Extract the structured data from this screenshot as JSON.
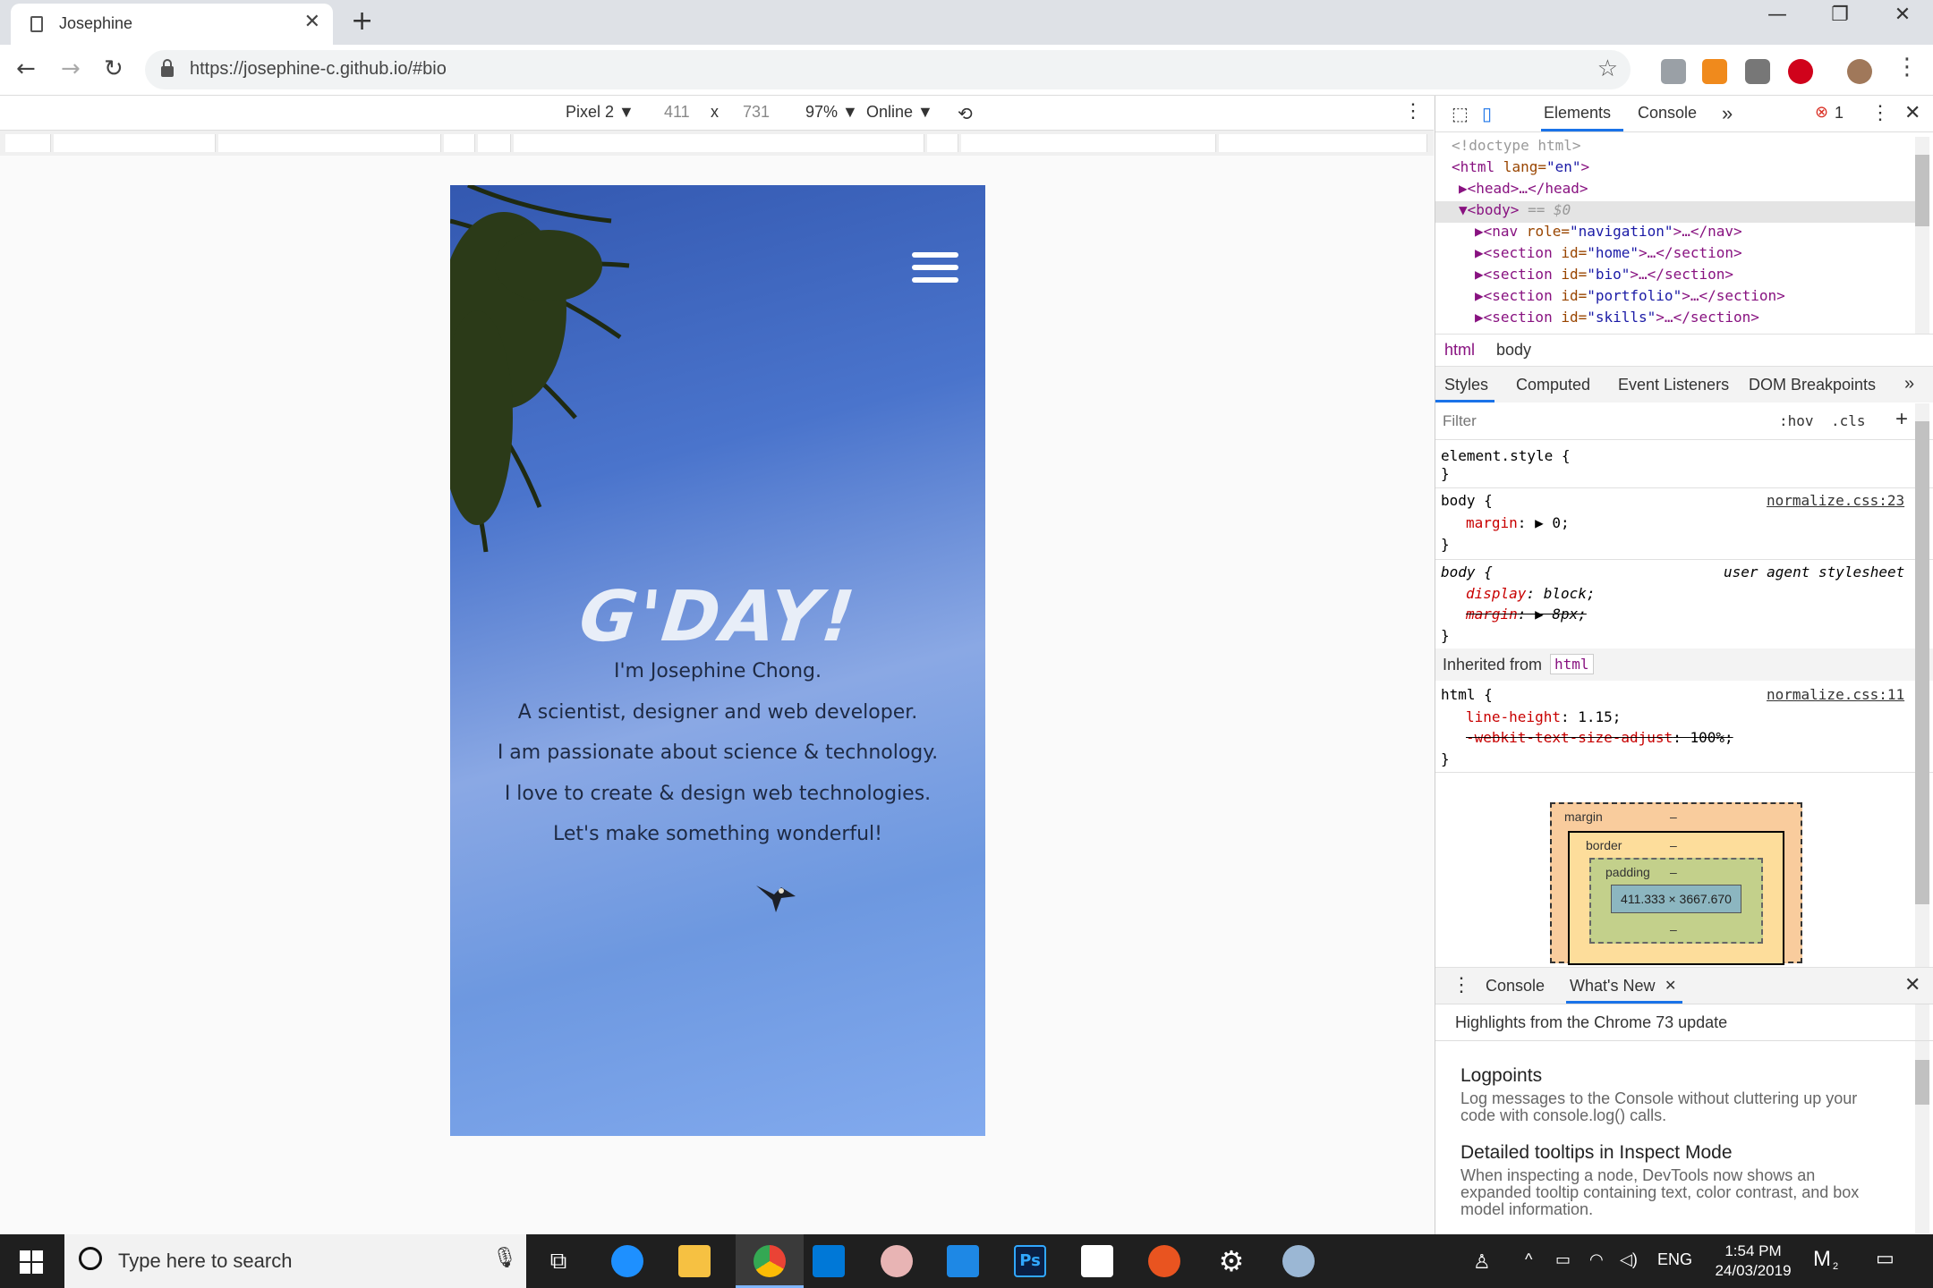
{
  "browser": {
    "tab_title": "Josephine",
    "url": "https://josephine-c.github.io/#bio",
    "colors": {
      "chrome_bg": "#dee1e6",
      "toolbar_bg": "#ffffff"
    }
  },
  "device_toolbar": {
    "device": "Pixel 2 ▼",
    "width": "411",
    "x": "x",
    "height": "731",
    "zoom": "97% ▼",
    "network": "Online ▼"
  },
  "page": {
    "heading": "G'DAY!",
    "lines": [
      "I'm Josephine Chong.",
      "A scientist, designer and web developer.",
      "I am passionate about science & technology.",
      "I love to create & design web technologies.",
      "Let's make something wonderful!"
    ]
  },
  "devtools": {
    "tabs": {
      "elements": "Elements",
      "console": "Console",
      "more": "»",
      "errors": "1"
    },
    "dom": [
      {
        "text": "<!doctype html>"
      },
      {
        "tag": "<html",
        "attr": " lang=",
        "val": "\"en\"",
        "end": ">"
      },
      {
        "tag": "▶<head>…</head>"
      },
      {
        "tag": "▼<body>",
        "extra": " == $0"
      },
      {
        "tag": "▶<nav",
        "attr": " role=",
        "val": "\"navigation\"",
        "end": ">…</nav>"
      },
      {
        "tag": "▶<section",
        "attr": " id=",
        "val": "\"home\"",
        "end": ">…</section>"
      },
      {
        "tag": "▶<section",
        "attr": " id=",
        "val": "\"bio\"",
        "end": ">…</section>"
      },
      {
        "tag": "▶<section",
        "attr": " id=",
        "val": "\"portfolio\"",
        "end": ">…</section>"
      },
      {
        "tag": "▶<section",
        "attr": " id=",
        "val": "\"skills\"",
        "end": ">…</section>"
      }
    ],
    "breadcrumb": [
      "html",
      "body"
    ],
    "subtabs": [
      "Styles",
      "Computed",
      "Event Listeners",
      "DOM Breakpoints",
      "»"
    ],
    "filter_placeholder": "Filter",
    "hov": ":hov",
    "cls": ".cls",
    "styles": {
      "element_style": "element.style {",
      "close": "}",
      "rule1_sel": "body {",
      "rule1_src": "normalize.css:23",
      "rule1_prop": "margin",
      "rule1_val": "▶ 0;",
      "rule2_sel": "body {",
      "rule2_src": "user agent stylesheet",
      "rule2_prop1": "display",
      "rule2_val1": "block;",
      "rule2_prop2": "margin",
      "rule2_val2": "▶ 8px;",
      "inherited_label": "Inherited from",
      "inherited_tag": "html",
      "rule3_sel": "html {",
      "rule3_src": "normalize.css:11",
      "rule3_prop1": "line-height",
      "rule3_val1": "1.15;",
      "rule3_prop2": "-webkit-text-size-adjust",
      "rule3_val2": "100%;"
    },
    "box_model": {
      "margin": "margin",
      "border": "border",
      "padding": "padding",
      "dash": "–",
      "content": "411.333 × 3667.670"
    },
    "drawer": {
      "tabs": [
        "Console",
        "What's New"
      ],
      "highlight": "Highlights from the Chrome 73 update",
      "items": [
        {
          "title": "Logpoints",
          "desc": "Log messages to the Console without cluttering up your code with console.log() calls."
        },
        {
          "title": "Detailed tooltips in Inspect Mode",
          "desc": "When inspecting a node, DevTools now shows an expanded tooltip containing text, color contrast, and box model information."
        }
      ]
    }
  },
  "taskbar": {
    "search_placeholder": "Type here to search",
    "time": "1:54 PM",
    "date": "24/03/2019",
    "lang": "ENG",
    "notif_count": "2"
  }
}
